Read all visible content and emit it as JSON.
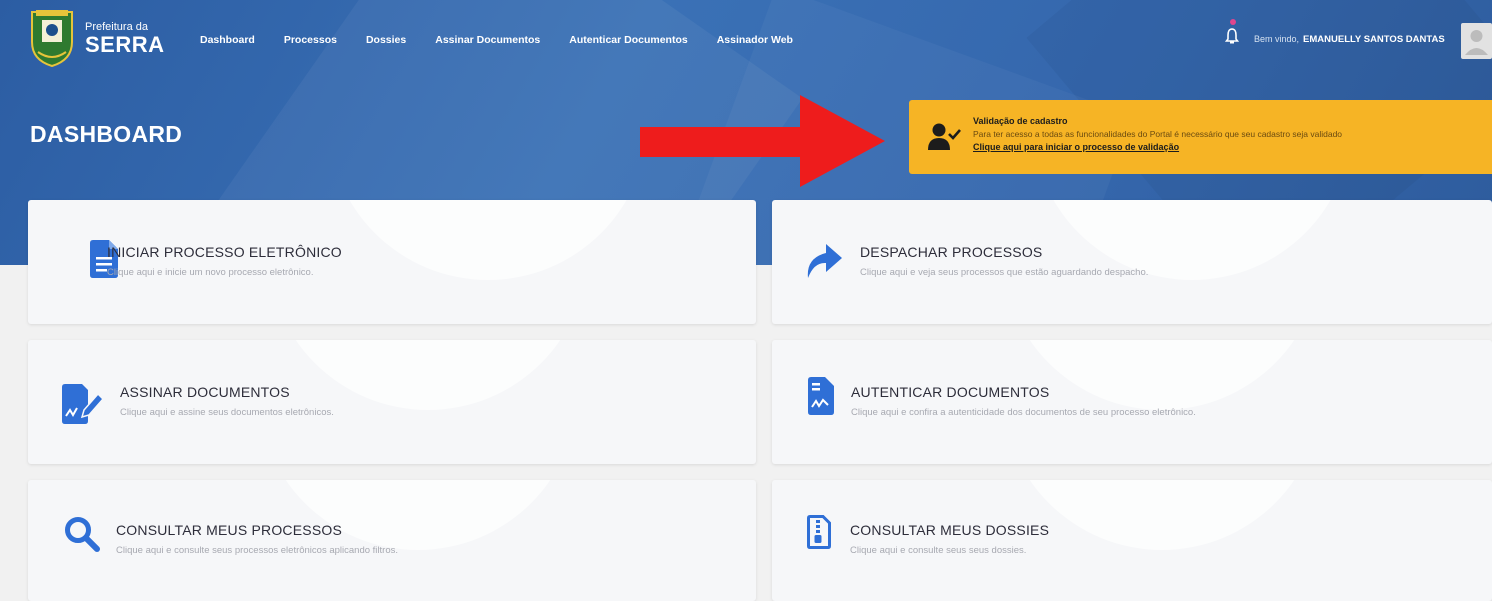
{
  "header": {
    "logo_small": "Prefeitura da",
    "logo_big": "SERRA",
    "nav": [
      "Dashboard",
      "Processos",
      "Dossies",
      "Assinar Documentos",
      "Autenticar Documentos",
      "Assinador Web"
    ],
    "welcome_label": "Bem vindo,",
    "user_name": "EMANUELLY SANTOS DANTAS"
  },
  "page": {
    "title": "DASHBOARD"
  },
  "banner": {
    "title": "Validação de cadastro",
    "text": "Para ter acesso a todas as funcionalidades do Portal é necessário que seu cadastro seja validado",
    "link": "Clique aqui para iniciar o processo de validação"
  },
  "cards": [
    {
      "title": "INICIAR PROCESSO ELETRÔNICO",
      "desc": "Clique aqui e inicie um novo processo eletrônico.",
      "icon": "document-icon"
    },
    {
      "title": "DESPACHAR PROCESSOS",
      "desc": "Clique aqui e veja seus processos que estão aguardando despacho.",
      "icon": "share-arrow-icon"
    },
    {
      "title": "ASSINAR DOCUMENTOS",
      "desc": "Clique aqui e assine seus documentos eletrônicos.",
      "icon": "sign-document-icon"
    },
    {
      "title": "AUTENTICAR DOCUMENTOS",
      "desc": "Clique aqui e confira a autenticidade dos documentos de seu processo eletrônico.",
      "icon": "certificate-document-icon"
    },
    {
      "title": "CONSULTAR MEUS PROCESSOS",
      "desc": "Clique aqui e consulte seus processos eletrônicos aplicando filtros.",
      "icon": "search-icon"
    },
    {
      "title": "CONSULTAR MEUS DOSSIES",
      "desc": "Clique aqui e consulte seus seus dossies.",
      "icon": "zip-file-icon"
    }
  ],
  "colors": {
    "hero": "#3567ad",
    "banner": "#f6b425",
    "icon_blue": "#2f6fd6",
    "arrow_red": "#ee1c1c"
  }
}
